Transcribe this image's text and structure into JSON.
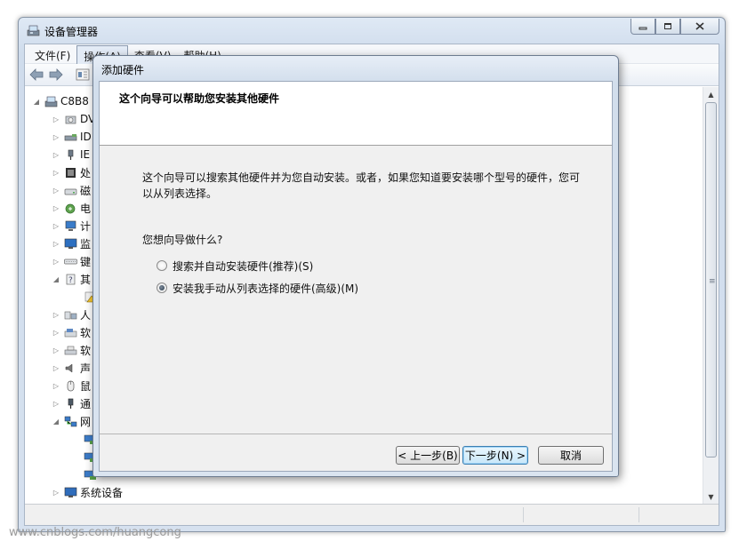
{
  "window": {
    "title": "设备管理器"
  },
  "menu": {
    "items": [
      "文件(F)",
      "操作(A)",
      "查看(V)",
      "帮助(H)"
    ]
  },
  "tree": {
    "root": "C8B8",
    "items": [
      {
        "label": "DV",
        "icon": "dvd-drive-icon"
      },
      {
        "label": "ID",
        "icon": "ide-controller-icon"
      },
      {
        "label": "IE",
        "icon": "ieee1394-icon"
      },
      {
        "label": "处",
        "icon": "processor-icon"
      },
      {
        "label": "磁",
        "icon": "disk-drive-icon"
      },
      {
        "label": "电",
        "icon": "battery-icon"
      },
      {
        "label": "计",
        "icon": "computer-icon"
      },
      {
        "label": "监",
        "icon": "monitor-icon"
      },
      {
        "label": "键",
        "icon": "keyboard-icon"
      },
      {
        "label": "其",
        "icon": "other-devices-icon"
      },
      {
        "label": "",
        "icon": "warning-device-icon"
      },
      {
        "label": "人",
        "icon": "hid-icon"
      },
      {
        "label": "软",
        "icon": "floppy-icon"
      },
      {
        "label": "软",
        "icon": "floppy-controller-icon"
      },
      {
        "label": "声",
        "icon": "sound-icon"
      },
      {
        "label": "鼠",
        "icon": "mouse-icon"
      },
      {
        "label": "通",
        "icon": "usb-icon"
      },
      {
        "label": "网",
        "icon": "network-icon"
      },
      {
        "label": "",
        "icon": "network-adapter-icon"
      },
      {
        "label": "",
        "icon": "network-adapter-icon"
      },
      {
        "label": "",
        "icon": "network-adapter-icon"
      },
      {
        "label": "系统设备",
        "icon": "system-devices-icon"
      }
    ]
  },
  "dialog": {
    "title": "添加硬件",
    "heading": "这个向导可以帮助您安装其他硬件",
    "description": "这个向导可以搜索其他硬件并为您自动安装。或者，如果您知道要安装哪个型号的硬件，您可以从列表选择。",
    "question": "您想向导做什么?",
    "options": [
      {
        "label": "搜索并自动安装硬件(推荐)(S)",
        "checked": false
      },
      {
        "label": "安装我手动从列表选择的硬件(高级)(M)",
        "checked": true
      }
    ],
    "buttons": {
      "back": "< 上一步(B)",
      "next": "下一步(N) >",
      "cancel": "取消"
    }
  },
  "watermark": "www.cnblogs.com/huangcong"
}
